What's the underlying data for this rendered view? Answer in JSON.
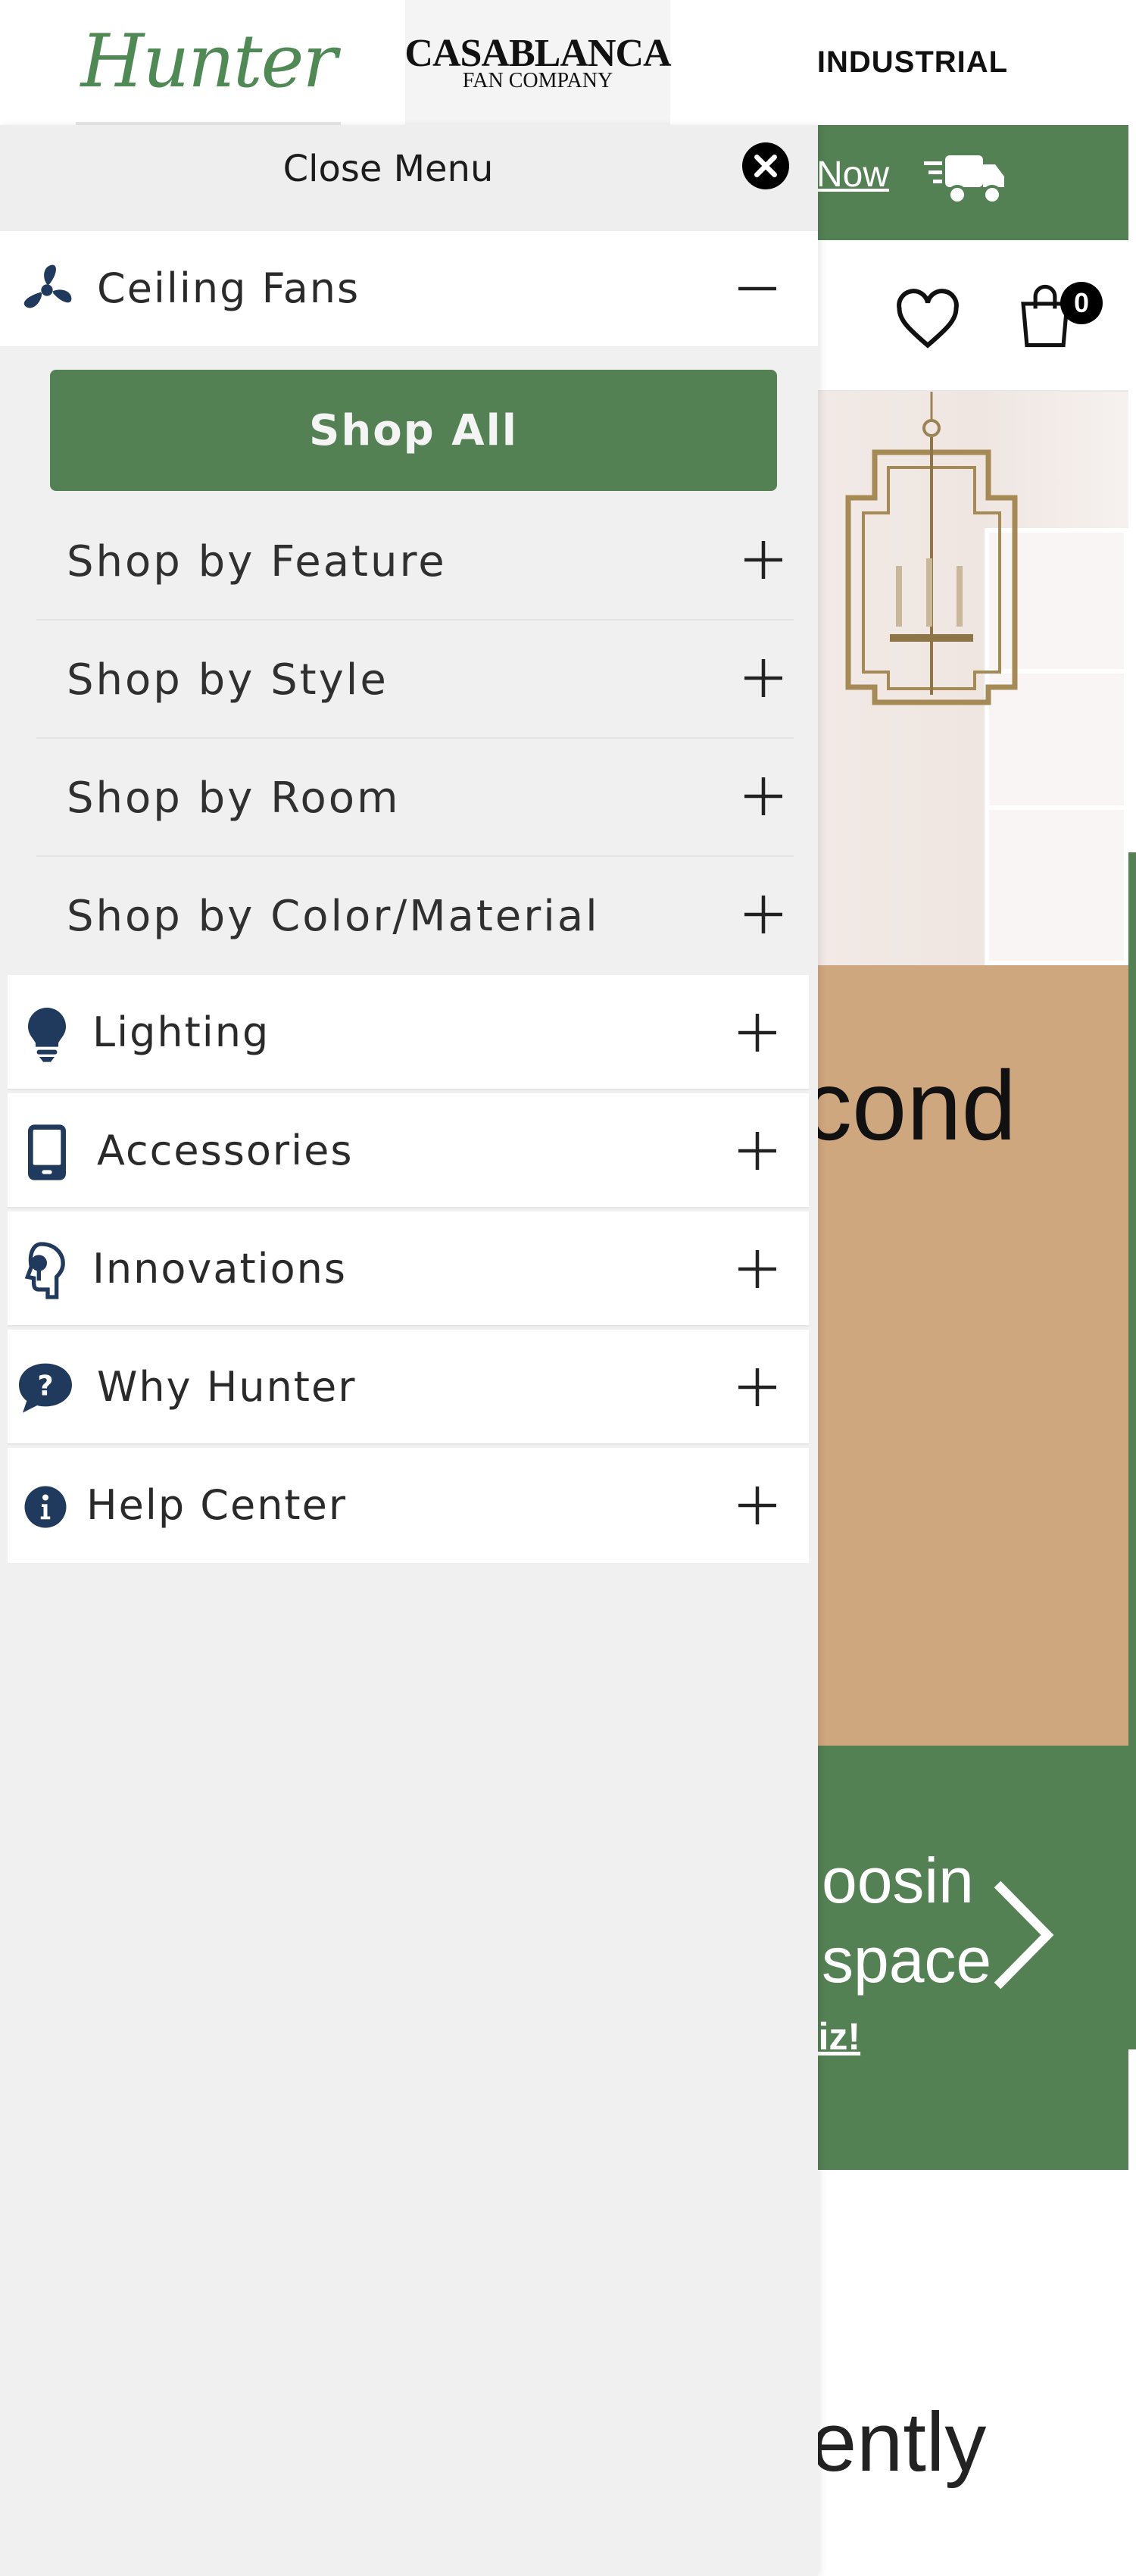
{
  "brands": {
    "hunter": "Hunter",
    "casablanca_line1": "CASABLANCA",
    "casablanca_line2": "FAN COMPANY",
    "industrial": "INDUSTRIAL"
  },
  "background_page": {
    "promo_link": "Now",
    "cart_count": "0",
    "hero_text": "cond",
    "quiz_line1": "oosin",
    "quiz_line2": "space",
    "quiz_link": "uiz!",
    "bottom_text": "ently"
  },
  "menu": {
    "close_label": "Close Menu",
    "expanded_category": {
      "label": "Ceiling Fans",
      "icon": "fan-icon",
      "shop_all": "Shop All",
      "subitems": [
        {
          "label": "Shop by Feature"
        },
        {
          "label": "Shop by Style"
        },
        {
          "label": "Shop by Room"
        },
        {
          "label": "Shop by Color/Material"
        }
      ]
    },
    "categories": [
      {
        "label": "Lighting",
        "icon": "lightbulb-icon"
      },
      {
        "label": "Accessories",
        "icon": "phone-icon"
      },
      {
        "label": "Innovations",
        "icon": "head-icon"
      },
      {
        "label": "Why Hunter",
        "icon": "question-bubble-icon"
      },
      {
        "label": "Help Center",
        "icon": "info-icon"
      }
    ]
  },
  "colors": {
    "brand_green": "#548154",
    "icon_navy": "#1f3a5c",
    "hero_beige": "#cfa77e",
    "drawer_bg": "#f0f0f0"
  }
}
